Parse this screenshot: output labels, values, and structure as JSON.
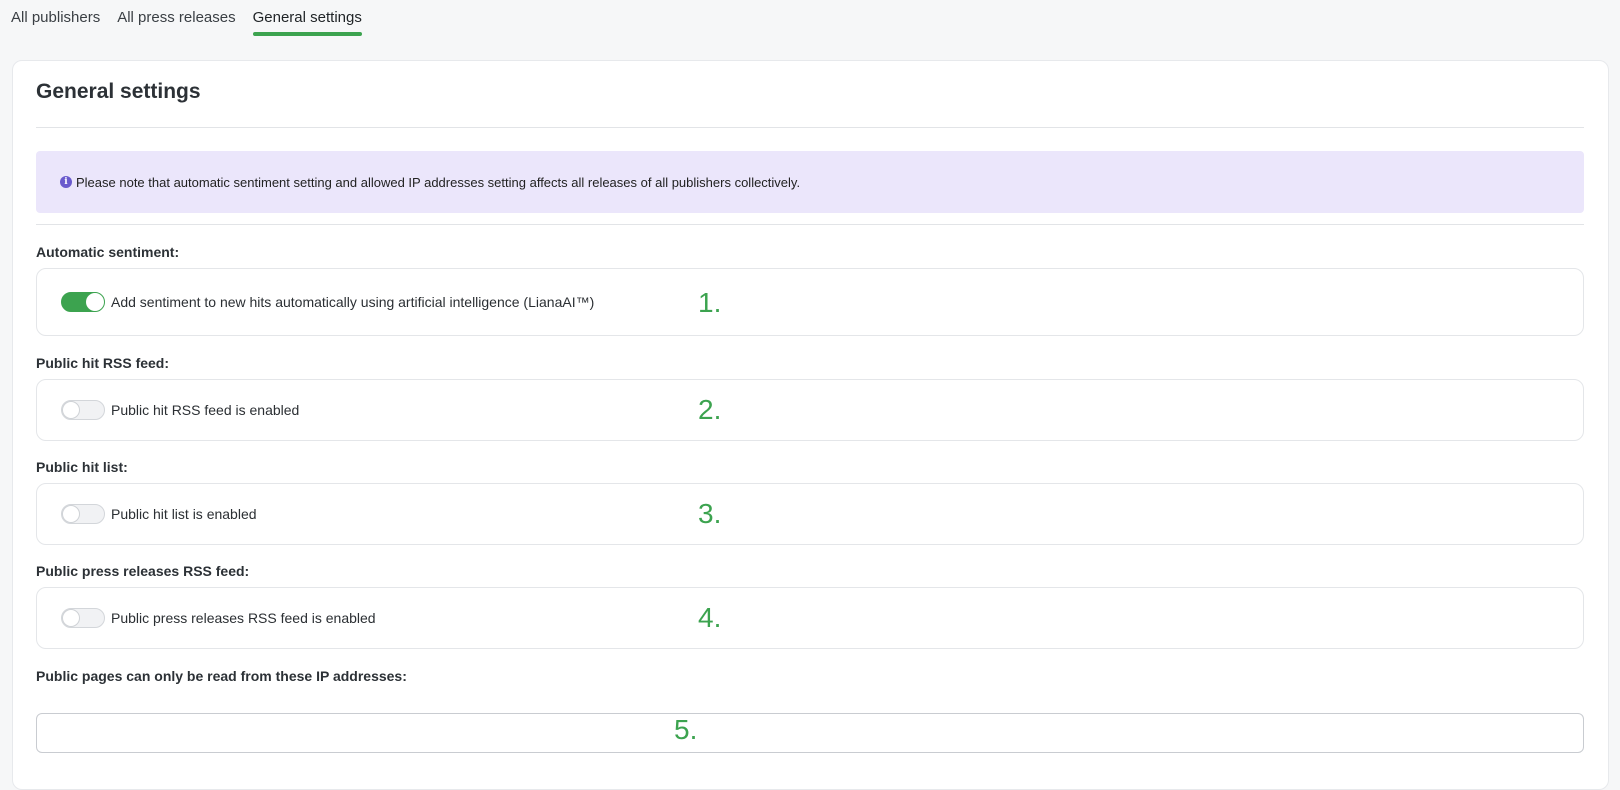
{
  "tabs": [
    {
      "label": "All publishers"
    },
    {
      "label": "All press releases"
    },
    {
      "label": "General settings",
      "active": true
    }
  ],
  "page": {
    "title": "General settings",
    "notice": "Please note that automatic sentiment setting and allowed IP addresses setting affects all releases of all publishers collectively."
  },
  "settings": [
    {
      "label": "Automatic sentiment:",
      "text": "Add sentiment to new hits automatically using artificial intelligence (LianaAI™)",
      "enabled": true,
      "marker": "1."
    },
    {
      "label": "Public hit RSS feed:",
      "text": "Public hit RSS feed is enabled",
      "enabled": false,
      "marker": "2."
    },
    {
      "label": "Public hit list:",
      "text": "Public hit list is enabled",
      "enabled": false,
      "marker": "3."
    },
    {
      "label": "Public press releases RSS feed:",
      "text": "Public press releases RSS feed is enabled",
      "enabled": false,
      "marker": "4."
    }
  ],
  "ip": {
    "label": "Public pages can only be read from these IP addresses:",
    "value": "",
    "marker": "5."
  },
  "colors": {
    "accent": "#3ca34f",
    "notice_bg": "#ebe6fb",
    "info_icon": "#6a5acd"
  },
  "icons": {
    "notice": "info-icon"
  }
}
